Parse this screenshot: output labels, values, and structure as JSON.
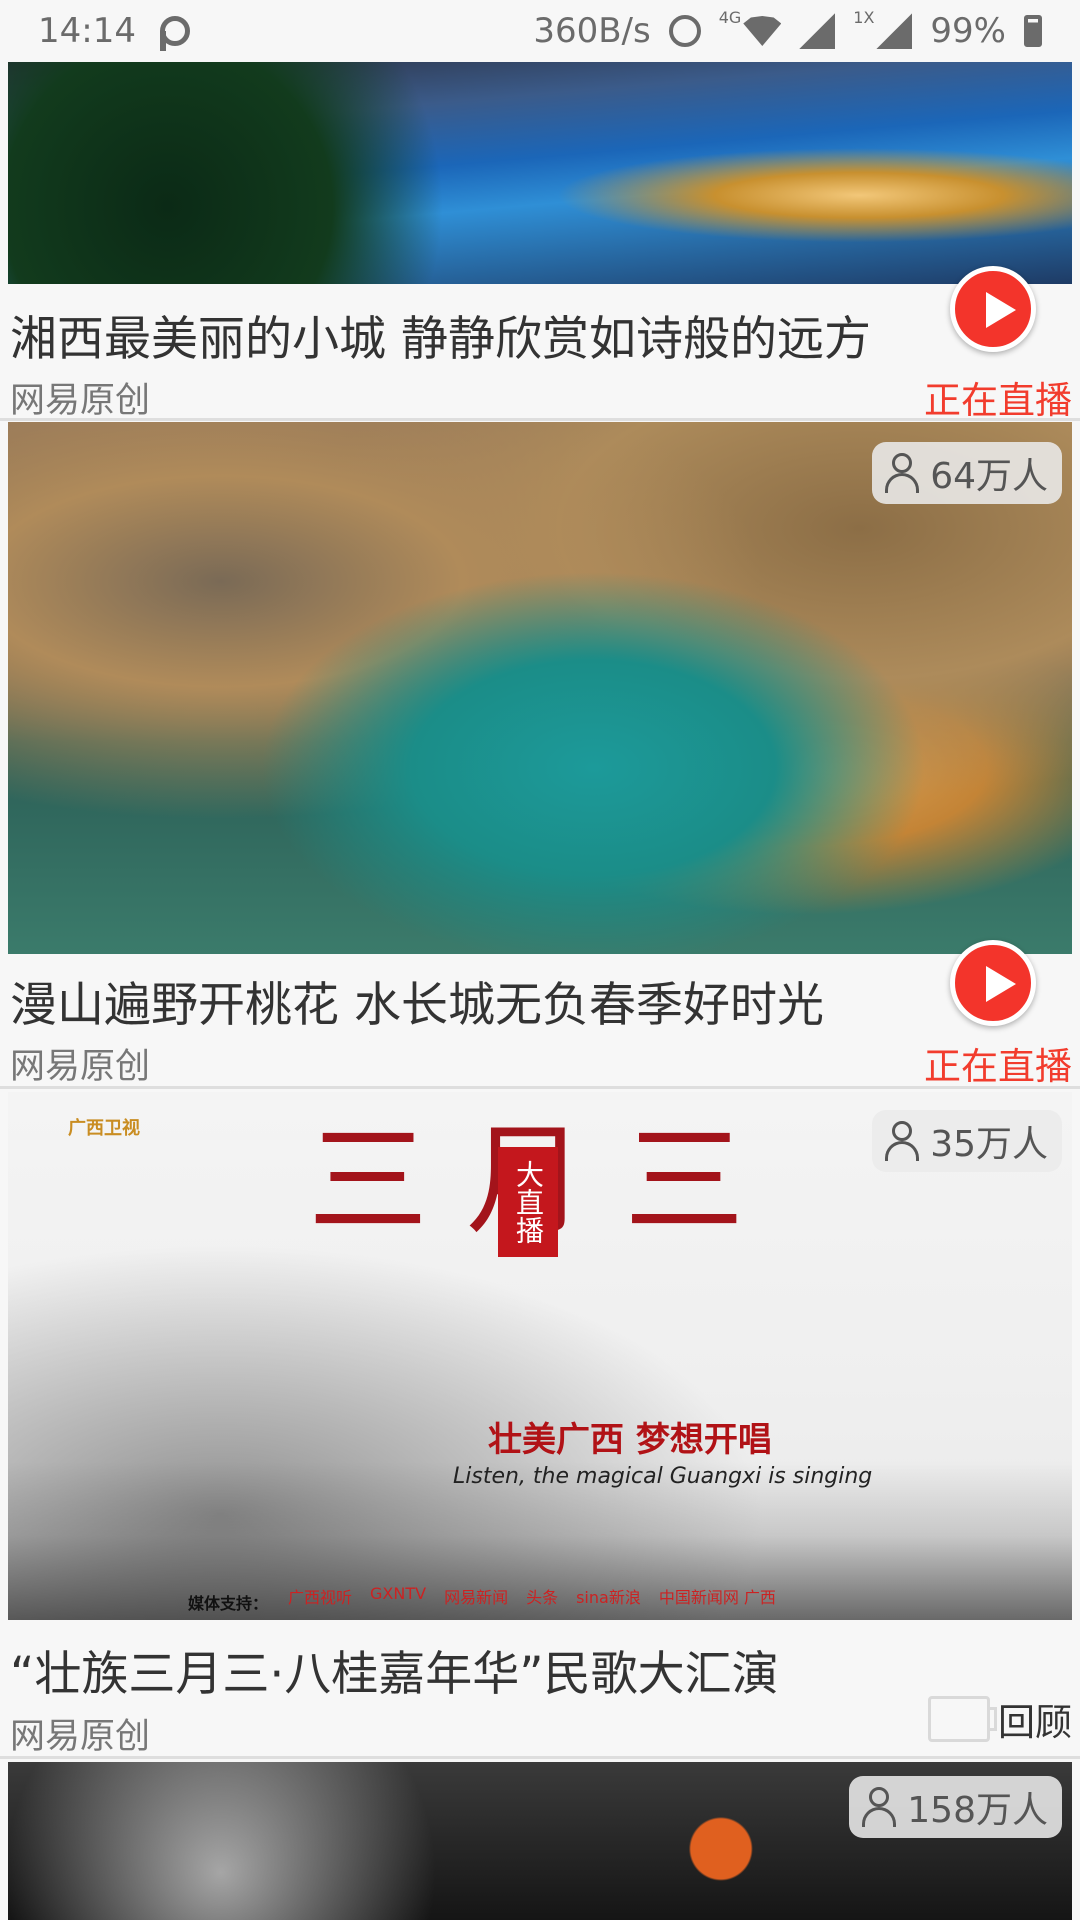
{
  "status_bar": {
    "time": "14:14",
    "net_speed": "360B/s",
    "net_4g": "4G",
    "net_1x": "1X",
    "battery": "99%"
  },
  "feed": [
    {
      "title": "湘西最美丽的小城 静静欣赏如诗般的远方",
      "source": "网易原创",
      "status": "正在直播"
    },
    {
      "title": "漫山遍野开桃花 水长城无负春季好时光",
      "source": "网易原创",
      "status": "正在直播",
      "viewers": "64万人"
    },
    {
      "title": "“壮族三月三·八桂嘉年华”民歌大汇演",
      "source": "网易原创",
      "status": "回顾",
      "viewers": "35万人",
      "banner": {
        "logo": "广西卫视",
        "glyphs": "三 月 三",
        "live_tag": "大直播",
        "slogan": "壮美广西 梦想开唱",
        "subtitle": "Listen, the magical Guangxi is singing",
        "support_label": "媒体支持：",
        "partners": [
          "广西视听",
          "GXNTV",
          "网易新闻",
          "头条",
          "sina新浪",
          "中国新闻网 广西"
        ]
      }
    },
    {
      "viewers": "158万人"
    }
  ]
}
